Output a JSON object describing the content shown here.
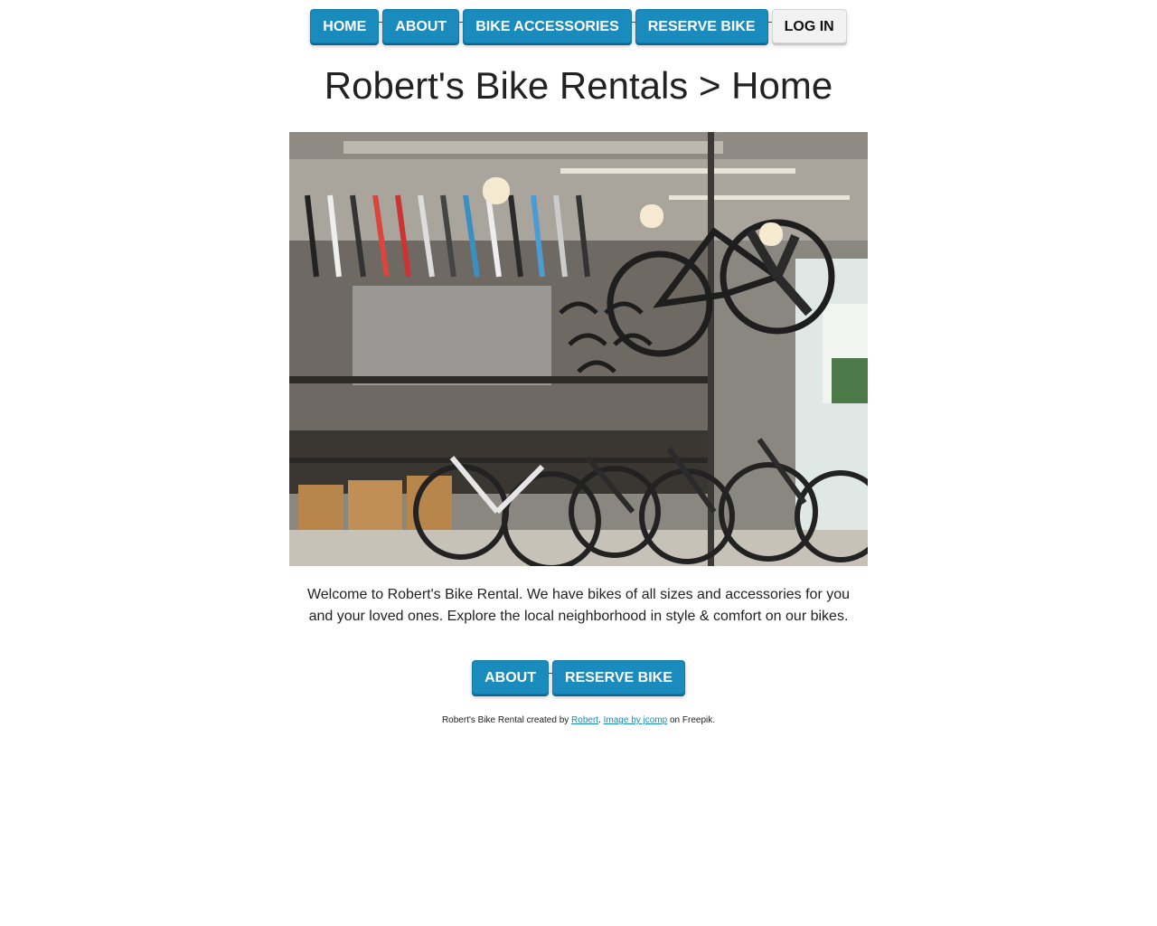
{
  "nav": {
    "items": [
      {
        "label": "HOME",
        "style": "primary"
      },
      {
        "label": "ABOUT",
        "style": "primary"
      },
      {
        "label": "BIKE ACCESSORIES",
        "style": "primary"
      },
      {
        "label": "RESERVE BIKE",
        "style": "primary"
      },
      {
        "label": "LOG IN",
        "style": "light"
      }
    ]
  },
  "page": {
    "title": "Robert's Bike Rentals > Home",
    "hero_image": "bike-shop-interior",
    "welcome": "Welcome to Robert's Bike Rental. We have bikes of all sizes and accessories for you and your loved ones. Explore the local neighborhood in style & comfort on our bikes."
  },
  "cta": {
    "about_label": "ABOUT",
    "reserve_label": "RESERVE BIKE"
  },
  "footer": {
    "prefix": "Robert's Bike Rental created by ",
    "author_link": "Robert",
    "separator": ". ",
    "image_link": "Image by jcomp",
    "suffix": " on Freepik."
  },
  "colors": {
    "primary": "#1a8bbd",
    "light": "#f2f2f2",
    "text": "#222222"
  }
}
